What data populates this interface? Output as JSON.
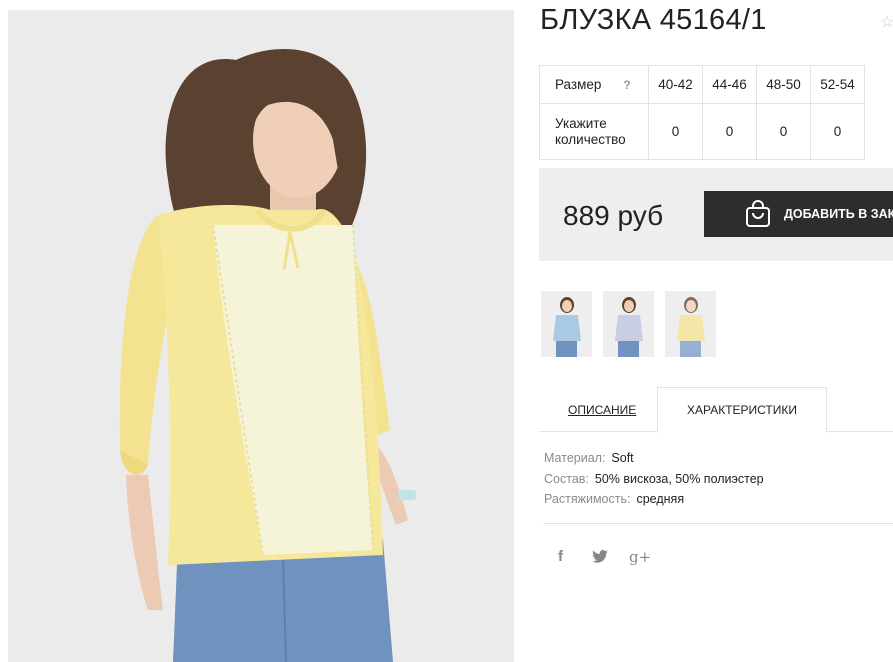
{
  "product": {
    "title": "БЛУЗКА 45164/1",
    "price": "889 руб",
    "add_to_cart_label": "ДОБАВИТЬ В ЗАКАЗ"
  },
  "size_table": {
    "size_label": "Размер",
    "help_label": "?",
    "quantity_label": "Укажите количество",
    "sizes": [
      "40-42",
      "44-46",
      "48-50",
      "52-54"
    ],
    "quantities": [
      "0",
      "0",
      "0",
      "0"
    ]
  },
  "thumbnails": [
    {
      "color": "#a9c9e4"
    },
    {
      "color": "#b6bcd8"
    },
    {
      "color": "#f3e7a8"
    }
  ],
  "tabs": {
    "description": "ОПИСАНИЕ",
    "characteristics": "ХАРАКТЕРИСТИКИ"
  },
  "characteristics": [
    {
      "key": "Материал:",
      "value": "Soft"
    },
    {
      "key": "Состав:",
      "value": "50% вискоза, 50% полиэстер"
    },
    {
      "key": "Растяжимость:",
      "value": "средняя"
    }
  ],
  "social": {
    "facebook": "f",
    "twitter_icon": "twitter-icon",
    "googleplus": "g+"
  },
  "colors": {
    "blouse": "#f5e89a",
    "panel": "#f6f4d8",
    "jeans": "#6f93be",
    "button": "#2d2d2d"
  }
}
